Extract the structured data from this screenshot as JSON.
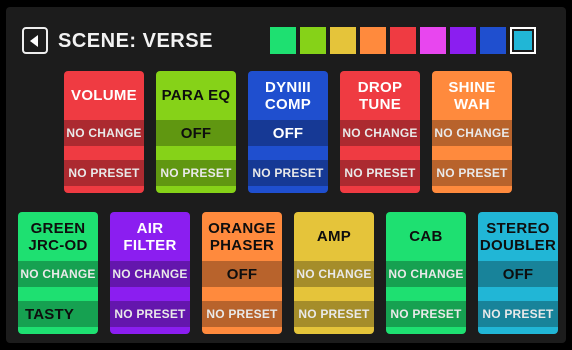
{
  "header": {
    "back_icon": "back-arrow-icon",
    "title": "SCENE: VERSE",
    "swatches": [
      {
        "color": "#1ee071",
        "selected": false
      },
      {
        "color": "#86d218",
        "selected": false
      },
      {
        "color": "#e5c43a",
        "selected": false
      },
      {
        "color": "#ff8a3d",
        "selected": false
      },
      {
        "color": "#ef3b42",
        "selected": false
      },
      {
        "color": "#e846ef",
        "selected": false
      },
      {
        "color": "#8b1ef0",
        "selected": false
      },
      {
        "color": "#1f4fcf",
        "selected": false
      },
      {
        "color": "#21b6d6",
        "selected": true
      }
    ]
  },
  "blocks": [
    {
      "name": "VOLUME",
      "state": "NO CHANGE",
      "preset": "NO PRESET",
      "color": "#ef3b42",
      "text_dark": false
    },
    {
      "name": "PARA EQ",
      "state": "OFF",
      "preset": "NO PRESET",
      "color": "#86d218",
      "text_dark": true
    },
    {
      "name": "DYNIII\nCOMP",
      "state": "OFF",
      "preset": "NO PRESET",
      "color": "#1f4fcf",
      "text_dark": false
    },
    {
      "name": "DROP\nTUNE",
      "state": "NO CHANGE",
      "preset": "NO PRESET",
      "color": "#ef3b42",
      "text_dark": false
    },
    {
      "name": "SHINE\nWAH",
      "state": "NO CHANGE",
      "preset": "NO PRESET",
      "color": "#ff8a3d",
      "text_dark": false
    },
    {
      "name": "GREEN\nJRC-OD",
      "state": "NO CHANGE",
      "preset": "TASTY",
      "color": "#1ee071",
      "text_dark": true
    },
    {
      "name": "AIR\nFILTER",
      "state": "NO CHANGE",
      "preset": "NO PRESET",
      "color": "#8b1ef0",
      "text_dark": false
    },
    {
      "name": "ORANGE\nPHASER",
      "state": "OFF",
      "preset": "NO PRESET",
      "color": "#ff8a3d",
      "text_dark": true
    },
    {
      "name": "AMP",
      "state": "NO CHANGE",
      "preset": "NO PRESET",
      "color": "#e5c43a",
      "text_dark": true
    },
    {
      "name": "CAB",
      "state": "NO CHANGE",
      "preset": "NO PRESET",
      "color": "#1ee071",
      "text_dark": true
    },
    {
      "name": "STEREO\nDOUBLER",
      "state": "OFF",
      "preset": "NO PRESET",
      "color": "#21b6d6",
      "text_dark": true
    }
  ]
}
